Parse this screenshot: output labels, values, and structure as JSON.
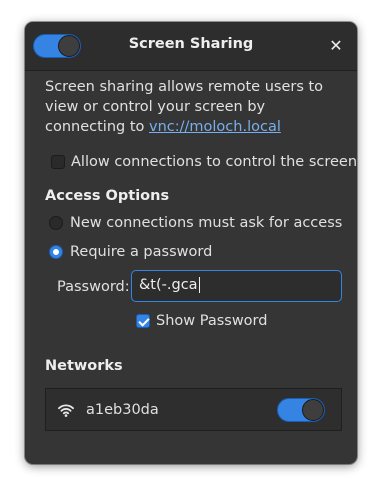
{
  "window": {
    "title": "Screen Sharing",
    "sharing_enabled": true,
    "close_icon": "close-icon"
  },
  "description": {
    "text": "Screen sharing allows remote users to view or control your screen by connecting to ",
    "link": "vnc://moloch.local"
  },
  "remote_control": {
    "label": "Allow connections to control the screen",
    "checked": false
  },
  "access_options": {
    "heading": "Access Options",
    "options": [
      {
        "label": "New connections must ask for access",
        "selected": false
      },
      {
        "label": "Require a password",
        "selected": true
      }
    ],
    "password": {
      "label": "Password:",
      "value": "&t(-.gca"
    },
    "show_password": {
      "label": "Show Password",
      "checked": true
    }
  },
  "networks": {
    "heading": "Networks",
    "items": [
      {
        "name": "a1eb30da",
        "icon": "wifi-icon",
        "enabled": true
      }
    ]
  },
  "colors": {
    "accent": "#3584e4",
    "link": "#78aeed",
    "background": "#353535"
  }
}
